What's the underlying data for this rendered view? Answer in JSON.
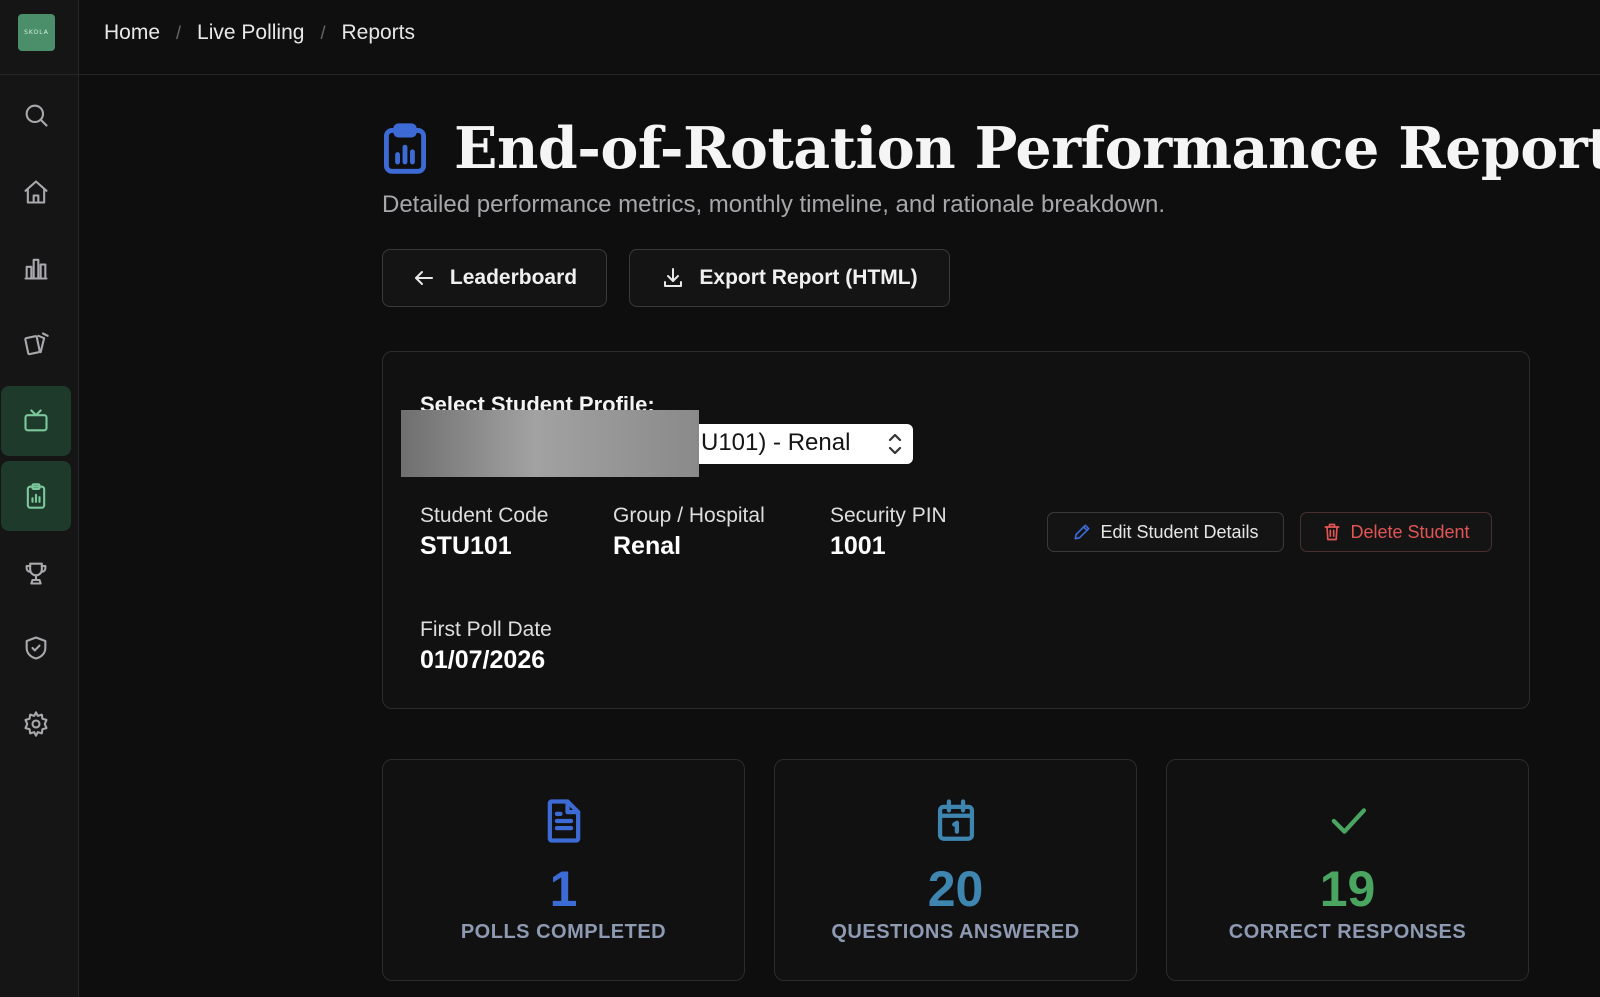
{
  "sidebar": {
    "logo_text": "SKOLA",
    "items": [
      {
        "name": "search-icon"
      },
      {
        "name": "home-icon"
      },
      {
        "name": "bar-chart-icon"
      },
      {
        "name": "cards-icon"
      },
      {
        "name": "tv-icon",
        "active": true
      },
      {
        "name": "clipboard-report-icon",
        "active": true
      },
      {
        "name": "trophy-icon"
      },
      {
        "name": "shield-check-icon"
      },
      {
        "name": "gear-icon"
      }
    ]
  },
  "breadcrumb": [
    "Home",
    "Live Polling",
    "Reports"
  ],
  "page": {
    "title": "End-of-Rotation Performance Report",
    "subtitle": "Detailed performance metrics, monthly timeline, and rationale breakdown."
  },
  "actions": {
    "leaderboard_label": "Leaderboard",
    "export_label": "Export Report (HTML)"
  },
  "profile": {
    "select_label": "Select Student Profile:",
    "selected_visible_text": "U101) - Renal",
    "fields": {
      "student_code_label": "Student Code",
      "student_code": "STU101",
      "group_label": "Group / Hospital",
      "group": "Renal",
      "pin_label": "Security PIN",
      "pin": "1001",
      "first_poll_label": "First Poll Date",
      "first_poll": "01/07/2026"
    },
    "edit_label": "Edit Student Details",
    "delete_label": "Delete Student"
  },
  "stats": [
    {
      "value": "1",
      "label": "POLLS COMPLETED",
      "color": "#3d6bd6",
      "icon": "document-icon"
    },
    {
      "value": "20",
      "label": "QUESTIONS ANSWERED",
      "color": "#3e86b0",
      "icon": "calendar-icon"
    },
    {
      "value": "19",
      "label": "CORRECT RESPONSES",
      "color": "#4aa561",
      "icon": "check-icon"
    }
  ],
  "colors": {
    "background": "#0e0e0f",
    "sidebar_active": "#1e3a2a",
    "accent_blue": "#3d6bd6",
    "danger": "#e25555",
    "logo": "#4a8f6a"
  }
}
